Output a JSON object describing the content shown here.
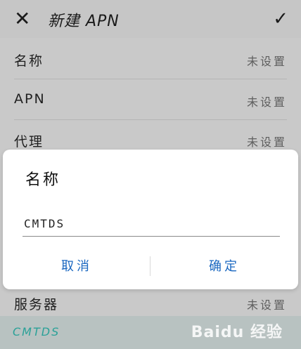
{
  "header": {
    "close_icon": "close-icon",
    "close_glyph": "✕",
    "title": "新建 APN",
    "confirm_icon": "check-icon",
    "confirm_glyph": "✓"
  },
  "rows": [
    {
      "label": "名称",
      "value": "未设置"
    },
    {
      "label": "APN",
      "value": "未设置"
    },
    {
      "label": "代理",
      "value": "未设置"
    },
    {
      "label": "服务器",
      "value": "未设置"
    }
  ],
  "dialog": {
    "title": "名称",
    "input_value": "CMTDS",
    "cancel_label": "取消",
    "ok_label": "确定"
  },
  "bottom": {
    "text": "CMTDS"
  },
  "watermark": {
    "text": "Baidu 经验"
  },
  "colors": {
    "accent": "#1a67c0",
    "teal": "#2aa198"
  }
}
